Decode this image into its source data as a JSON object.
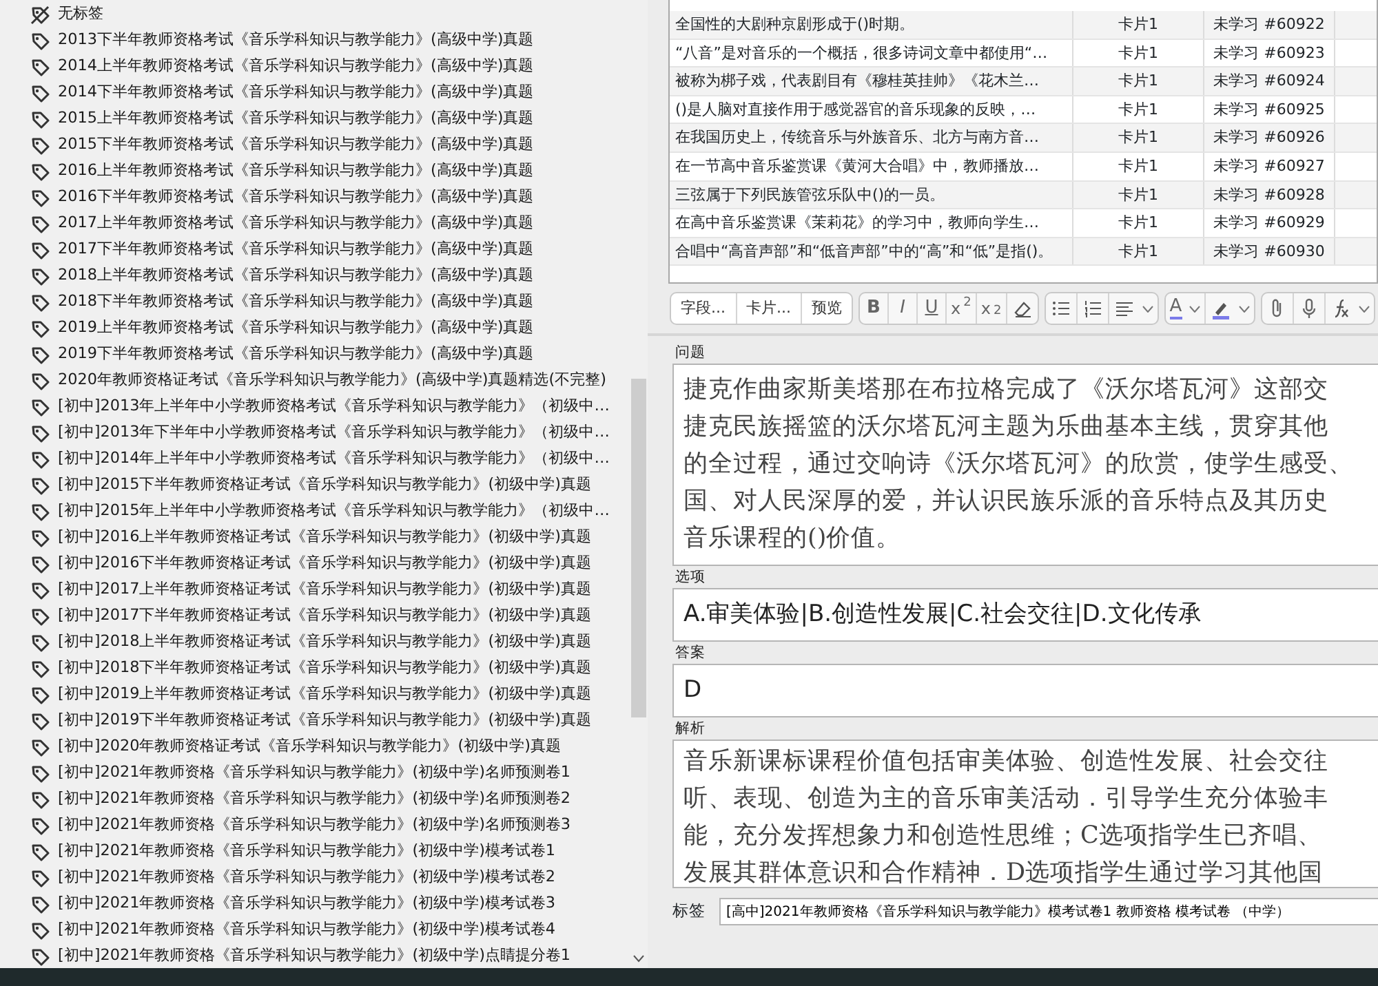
{
  "tag_list": {
    "items": [
      {
        "kind": "untagged",
        "label": "无标签"
      },
      {
        "kind": "tag",
        "label": "2013下半年教师资格考试《音乐学科知识与教学能力》(高级中学)真题"
      },
      {
        "kind": "tag",
        "label": "2014上半年教师资格考试《音乐学科知识与教学能力》(高级中学)真题"
      },
      {
        "kind": "tag",
        "label": "2014下半年教师资格考试《音乐学科知识与教学能力》(高级中学)真题"
      },
      {
        "kind": "tag",
        "label": "2015上半年教师资格考试《音乐学科知识与教学能力》(高级中学)真题"
      },
      {
        "kind": "tag",
        "label": "2015下半年教师资格考试《音乐学科知识与教学能力》(高级中学)真题"
      },
      {
        "kind": "tag",
        "label": "2016上半年教师资格考试《音乐学科知识与教学能力》(高级中学)真题"
      },
      {
        "kind": "tag",
        "label": "2016下半年教师资格考试《音乐学科知识与教学能力》(高级中学)真题"
      },
      {
        "kind": "tag",
        "label": "2017上半年教师资格考试《音乐学科知识与教学能力》(高级中学)真题"
      },
      {
        "kind": "tag",
        "label": "2017下半年教师资格考试《音乐学科知识与教学能力》(高级中学)真题"
      },
      {
        "kind": "tag",
        "label": "2018上半年教师资格考试《音乐学科知识与教学能力》(高级中学)真题"
      },
      {
        "kind": "tag",
        "label": "2018下半年教师资格考试《音乐学科知识与教学能力》(高级中学)真题"
      },
      {
        "kind": "tag",
        "label": "2019上半年教师资格考试《音乐学科知识与教学能力》(高级中学)真题"
      },
      {
        "kind": "tag",
        "label": "2019下半年教师资格考试《音乐学科知识与教学能力》(高级中学)真题"
      },
      {
        "kind": "tag",
        "label": "2020年教师资格证考试《音乐学科知识与教学能力》(高级中学)真题精选(不完整)"
      },
      {
        "kind": "tag",
        "label": "[初中]2013年上半年中小学教师资格考试《音乐学科知识与教学能力》（初级中…"
      },
      {
        "kind": "tag",
        "label": "[初中]2013年下半年中小学教师资格考试《音乐学科知识与教学能力》（初级中…"
      },
      {
        "kind": "tag",
        "label": "[初中]2014年上半年中小学教师资格考试《音乐学科知识与教学能力》（初级中…"
      },
      {
        "kind": "tag",
        "label": "[初中]2015下半年教师资格证考试《音乐学科知识与教学能力》(初级中学)真题"
      },
      {
        "kind": "tag",
        "label": "[初中]2015年上半年中小学教师资格考试《音乐学科知识与教学能力》（初级中…"
      },
      {
        "kind": "tag",
        "label": "[初中]2016上半年教师资格证考试《音乐学科知识与教学能力》(初级中学)真题"
      },
      {
        "kind": "tag",
        "label": "[初中]2016下半年教师资格证考试《音乐学科知识与教学能力》(初级中学)真题"
      },
      {
        "kind": "tag",
        "label": "[初中]2017上半年教师资格证考试《音乐学科知识与教学能力》(初级中学)真题"
      },
      {
        "kind": "tag",
        "label": "[初中]2017下半年教师资格证考试《音乐学科知识与教学能力》(初级中学)真题"
      },
      {
        "kind": "tag",
        "label": "[初中]2018上半年教师资格证考试《音乐学科知识与教学能力》(初级中学)真题"
      },
      {
        "kind": "tag",
        "label": "[初中]2018下半年教师资格证考试《音乐学科知识与教学能力》(初级中学)真题"
      },
      {
        "kind": "tag",
        "label": "[初中]2019上半年教师资格证考试《音乐学科知识与教学能力》(初级中学)真题"
      },
      {
        "kind": "tag",
        "label": "[初中]2019下半年教师资格证考试《音乐学科知识与教学能力》(初级中学)真题"
      },
      {
        "kind": "tag",
        "label": "[初中]2020年教师资格证考试《音乐学科知识与教学能力》(初级中学)真题"
      },
      {
        "kind": "tag",
        "label": "[初中]2021年教师资格《音乐学科知识与教学能力》(初级中学)名师预测卷1"
      },
      {
        "kind": "tag",
        "label": "[初中]2021年教师资格《音乐学科知识与教学能力》(初级中学)名师预测卷2"
      },
      {
        "kind": "tag",
        "label": "[初中]2021年教师资格《音乐学科知识与教学能力》(初级中学)名师预测卷3"
      },
      {
        "kind": "tag",
        "label": "[初中]2021年教师资格《音乐学科知识与教学能力》(初级中学)模考试卷1"
      },
      {
        "kind": "tag",
        "label": "[初中]2021年教师资格《音乐学科知识与教学能力》(初级中学)模考试卷2"
      },
      {
        "kind": "tag",
        "label": "[初中]2021年教师资格《音乐学科知识与教学能力》(初级中学)模考试卷3"
      },
      {
        "kind": "tag",
        "label": "[初中]2021年教师资格《音乐学科知识与教学能力》(初级中学)模考试卷4"
      },
      {
        "kind": "tag",
        "label": "[初中]2021年教师资格《音乐学科知识与教学能力》(初级中学)点睛提分卷1"
      }
    ]
  },
  "card_table": {
    "rows": [
      {
        "question": "全国性的大剧种京剧形成于()时期。",
        "card": "卡片1",
        "status": "未学习 #60922"
      },
      {
        "question": "“八音”是对音乐的一个概括，很多诗词文章中都使用“…",
        "card": "卡片1",
        "status": "未学习 #60923"
      },
      {
        "question": "被称为梆子戏，代表剧目有《穆桂英挂帅》《花木兰…",
        "card": "卡片1",
        "status": "未学习 #60924"
      },
      {
        "question": "()是人脑对直接作用于感觉器官的音乐现象的反映，…",
        "card": "卡片1",
        "status": "未学习 #60925"
      },
      {
        "question": "在我国历史上，传统音乐与外族音乐、北方与南方音…",
        "card": "卡片1",
        "status": "未学习 #60926"
      },
      {
        "question": "在一节高中音乐鉴赏课《黄河大合唱》中，教师播放…",
        "card": "卡片1",
        "status": "未学习 #60927"
      },
      {
        "question": "三弦属于下列民族管弦乐队中()的一员。",
        "card": "卡片1",
        "status": "未学习 #60928"
      },
      {
        "question": "在高中音乐鉴赏课《茉莉花》的学习中，教师向学生…",
        "card": "卡片1",
        "status": "未学习 #60929"
      },
      {
        "question": "合唱中“高音声部”和“低音声部”中的“高”和“低”是指()。",
        "card": "卡片1",
        "status": "未学习 #60930"
      }
    ]
  },
  "toolbar": {
    "groups": [
      [
        {
          "kind": "text",
          "label": "字段..."
        },
        {
          "kind": "text",
          "label": "卡片..."
        },
        {
          "kind": "text",
          "label": "预览"
        }
      ],
      [
        {
          "kind": "bold",
          "label": "B"
        },
        {
          "kind": "italic",
          "label": "I"
        },
        {
          "kind": "underline",
          "label": "U"
        },
        {
          "kind": "glyph",
          "label": "x$^{2}$"
        },
        {
          "kind": "glyph",
          "label": "x$_{2}$"
        },
        {
          "kind": "eraser"
        }
      ],
      [
        {
          "kind": "bullets"
        },
        {
          "kind": "numbers"
        },
        {
          "kind": "align",
          "dropdown": true
        }
      ],
      [
        {
          "kind": "textcolor",
          "label": "A",
          "dropdown": true,
          "color": "#7b7bea"
        },
        {
          "kind": "highlight",
          "dropdown": true,
          "color": "#7b7bea"
        }
      ],
      [
        {
          "kind": "clip"
        },
        {
          "kind": "mic"
        },
        {
          "kind": "formula",
          "dropdown": true
        }
      ]
    ]
  },
  "fields": [
    {
      "label": "问题",
      "kind": "paragraph",
      "lines": [
        "捷克作曲家斯美塔那在布拉格完成了《沃尔塔瓦河》这部交",
        "捷克民族摇篮的沃尔塔瓦河主题为乐曲基本主线，贯穿其他",
        "的全过程，通过交响诗《沃尔塔瓦河》的欣赏，使学生感受、",
        "国、对人民深厚的爱，并认识民族乐派的音乐特点及其历史",
        "音乐课程的()价值。"
      ]
    },
    {
      "label": "选项",
      "kind": "line",
      "lines": [
        "A.审美体验|B.创造性发展|C.社会交往|D.文化传承"
      ]
    },
    {
      "label": "答案",
      "kind": "line",
      "lines": [
        "D"
      ]
    },
    {
      "label": "解析",
      "kind": "paragraph",
      "lines": [
        "音乐新课标课程价值包括审美体验、创造性发展、社会交往",
        "听、表现、创造为主的音乐审美活动．引导学生充分体验丰",
        "能，充分发挥想象力和创造性思维；C选项指学生已齐唱、",
        "发展其群体意识和合作精神．D选项指学生通过学习其他国"
      ]
    }
  ],
  "tags": {
    "label": "标签",
    "value": "[高中]2021年教师资格《音乐学科知识与教学能力》模考试卷1 教师资格 模考试卷 （中学）"
  }
}
